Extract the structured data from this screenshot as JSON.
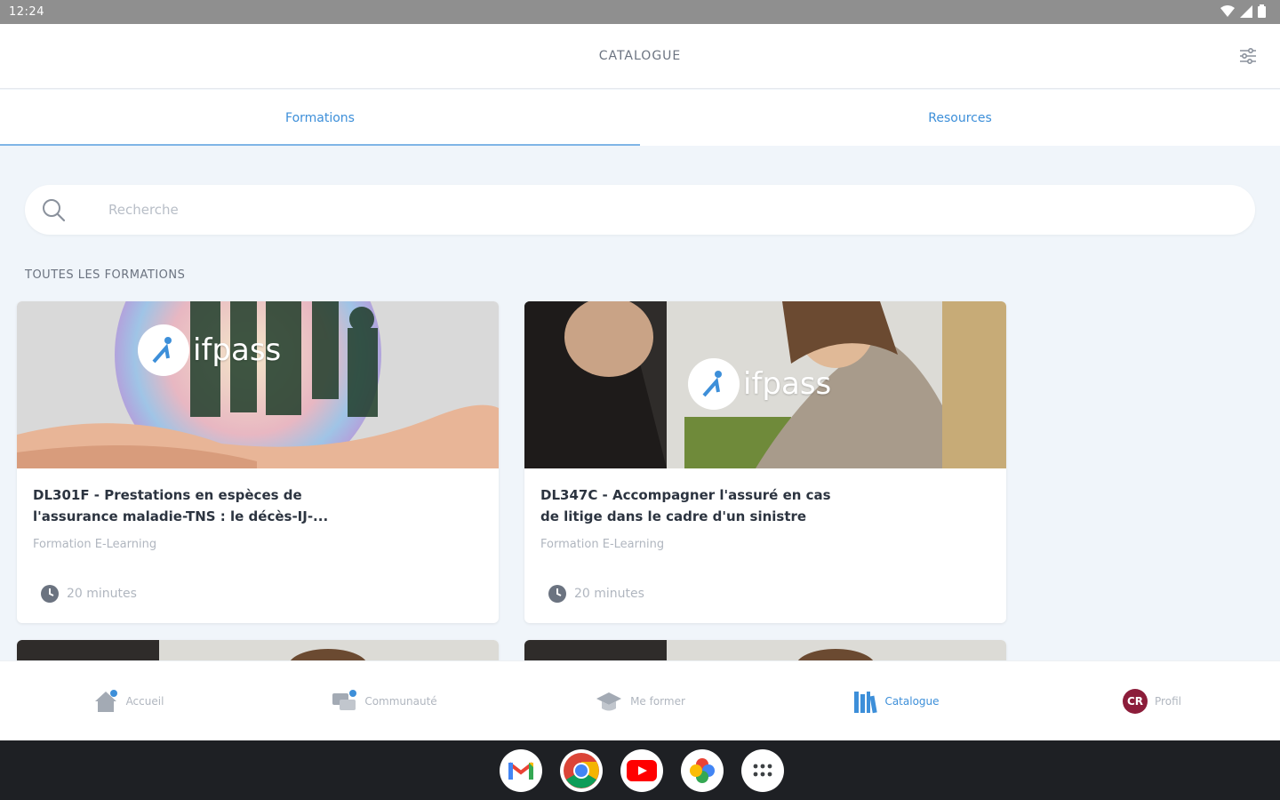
{
  "status_bar": {
    "time": "12:24"
  },
  "header": {
    "title": "CATALOGUE"
  },
  "tabs": [
    {
      "label": "Formations",
      "active": true
    },
    {
      "label": "Resources",
      "active": false
    }
  ],
  "search": {
    "placeholder": "Recherche",
    "value": ""
  },
  "section": {
    "title": "TOUTES LES FORMATIONS"
  },
  "brand": {
    "logo_text": "ifpass",
    "accent": "#3d8fd9"
  },
  "cards": [
    {
      "title_line1": "DL301F - Prestations en espèces de",
      "title_line2": "l'assurance maladie-TNS : le décès-IJ-...",
      "type": "Formation E-Learning",
      "duration": "20 minutes"
    },
    {
      "title_line1": "DL347C - Accompagner l'assuré en cas",
      "title_line2": "de litige dans le cadre d'un sinistre",
      "type": "Formation E-Learning",
      "duration": "20 minutes"
    }
  ],
  "bottom_nav": [
    {
      "label": "Accueil",
      "icon": "home-icon"
    },
    {
      "label": "Communauté",
      "icon": "community-icon"
    },
    {
      "label": "Me former",
      "icon": "graduation-cap-icon"
    },
    {
      "label": "Catalogue",
      "icon": "library-icon",
      "active": true
    },
    {
      "label": "Profil",
      "icon": "avatar-icon",
      "initials": "CR"
    }
  ],
  "dock": [
    {
      "app": "Gmail",
      "icon": "gmail-icon"
    },
    {
      "app": "Chrome",
      "icon": "chrome-icon"
    },
    {
      "app": "YouTube",
      "icon": "youtube-icon"
    },
    {
      "app": "Photos",
      "icon": "photos-icon"
    },
    {
      "app": "Apps",
      "icon": "app-grid-icon"
    }
  ]
}
